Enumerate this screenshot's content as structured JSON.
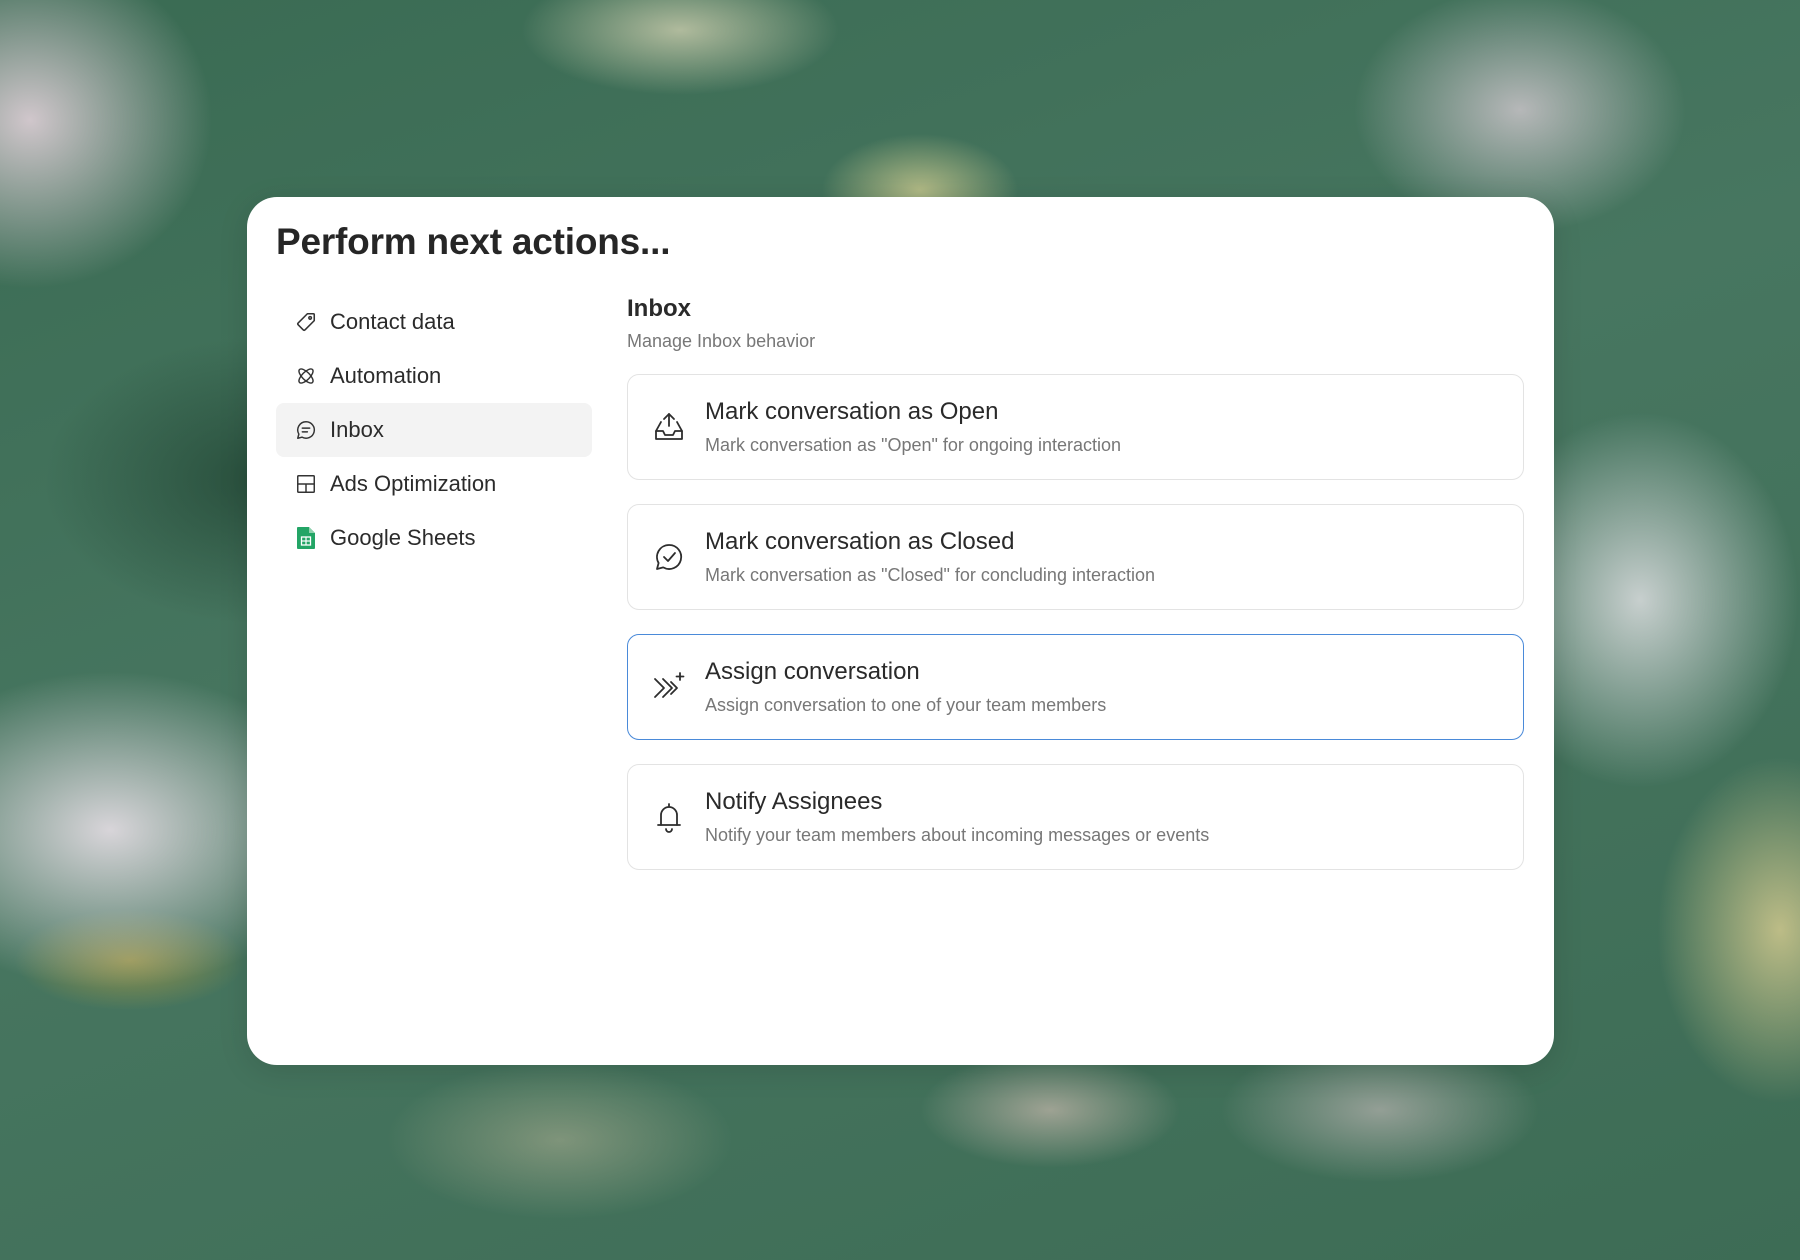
{
  "dialog": {
    "title": "Perform next actions..."
  },
  "sidebar": {
    "items": [
      {
        "label": "Contact data",
        "icon": "tag-icon",
        "active": false
      },
      {
        "label": "Automation",
        "icon": "atom-icon",
        "active": false
      },
      {
        "label": "Inbox",
        "icon": "chat-bubble-icon",
        "active": true
      },
      {
        "label": "Ads Optimization",
        "icon": "layout-icon",
        "active": false
      },
      {
        "label": "Google Sheets",
        "icon": "google-sheets-icon",
        "active": false
      }
    ]
  },
  "main": {
    "section_title": "Inbox",
    "section_subtitle": "Manage Inbox behavior",
    "actions": [
      {
        "title": "Mark conversation as Open",
        "description": "Mark conversation as \"Open\" for ongoing interaction",
        "icon": "inbox-upload-icon",
        "selected": false
      },
      {
        "title": "Mark conversation as Closed",
        "description": "Mark conversation as \"Closed\" for concluding interaction",
        "icon": "chat-check-icon",
        "selected": false
      },
      {
        "title": "Assign conversation",
        "description": "Assign conversation to one of your team members",
        "icon": "assign-arrows-icon",
        "selected": true
      },
      {
        "title": "Notify Assignees",
        "description": "Notify your team members about incoming messages or events",
        "icon": "bell-icon",
        "selected": false
      }
    ]
  },
  "colors": {
    "selected_border": "#4a8ad9",
    "active_item_bg": "#f3f3f3",
    "sheets_green": "#23a566"
  }
}
